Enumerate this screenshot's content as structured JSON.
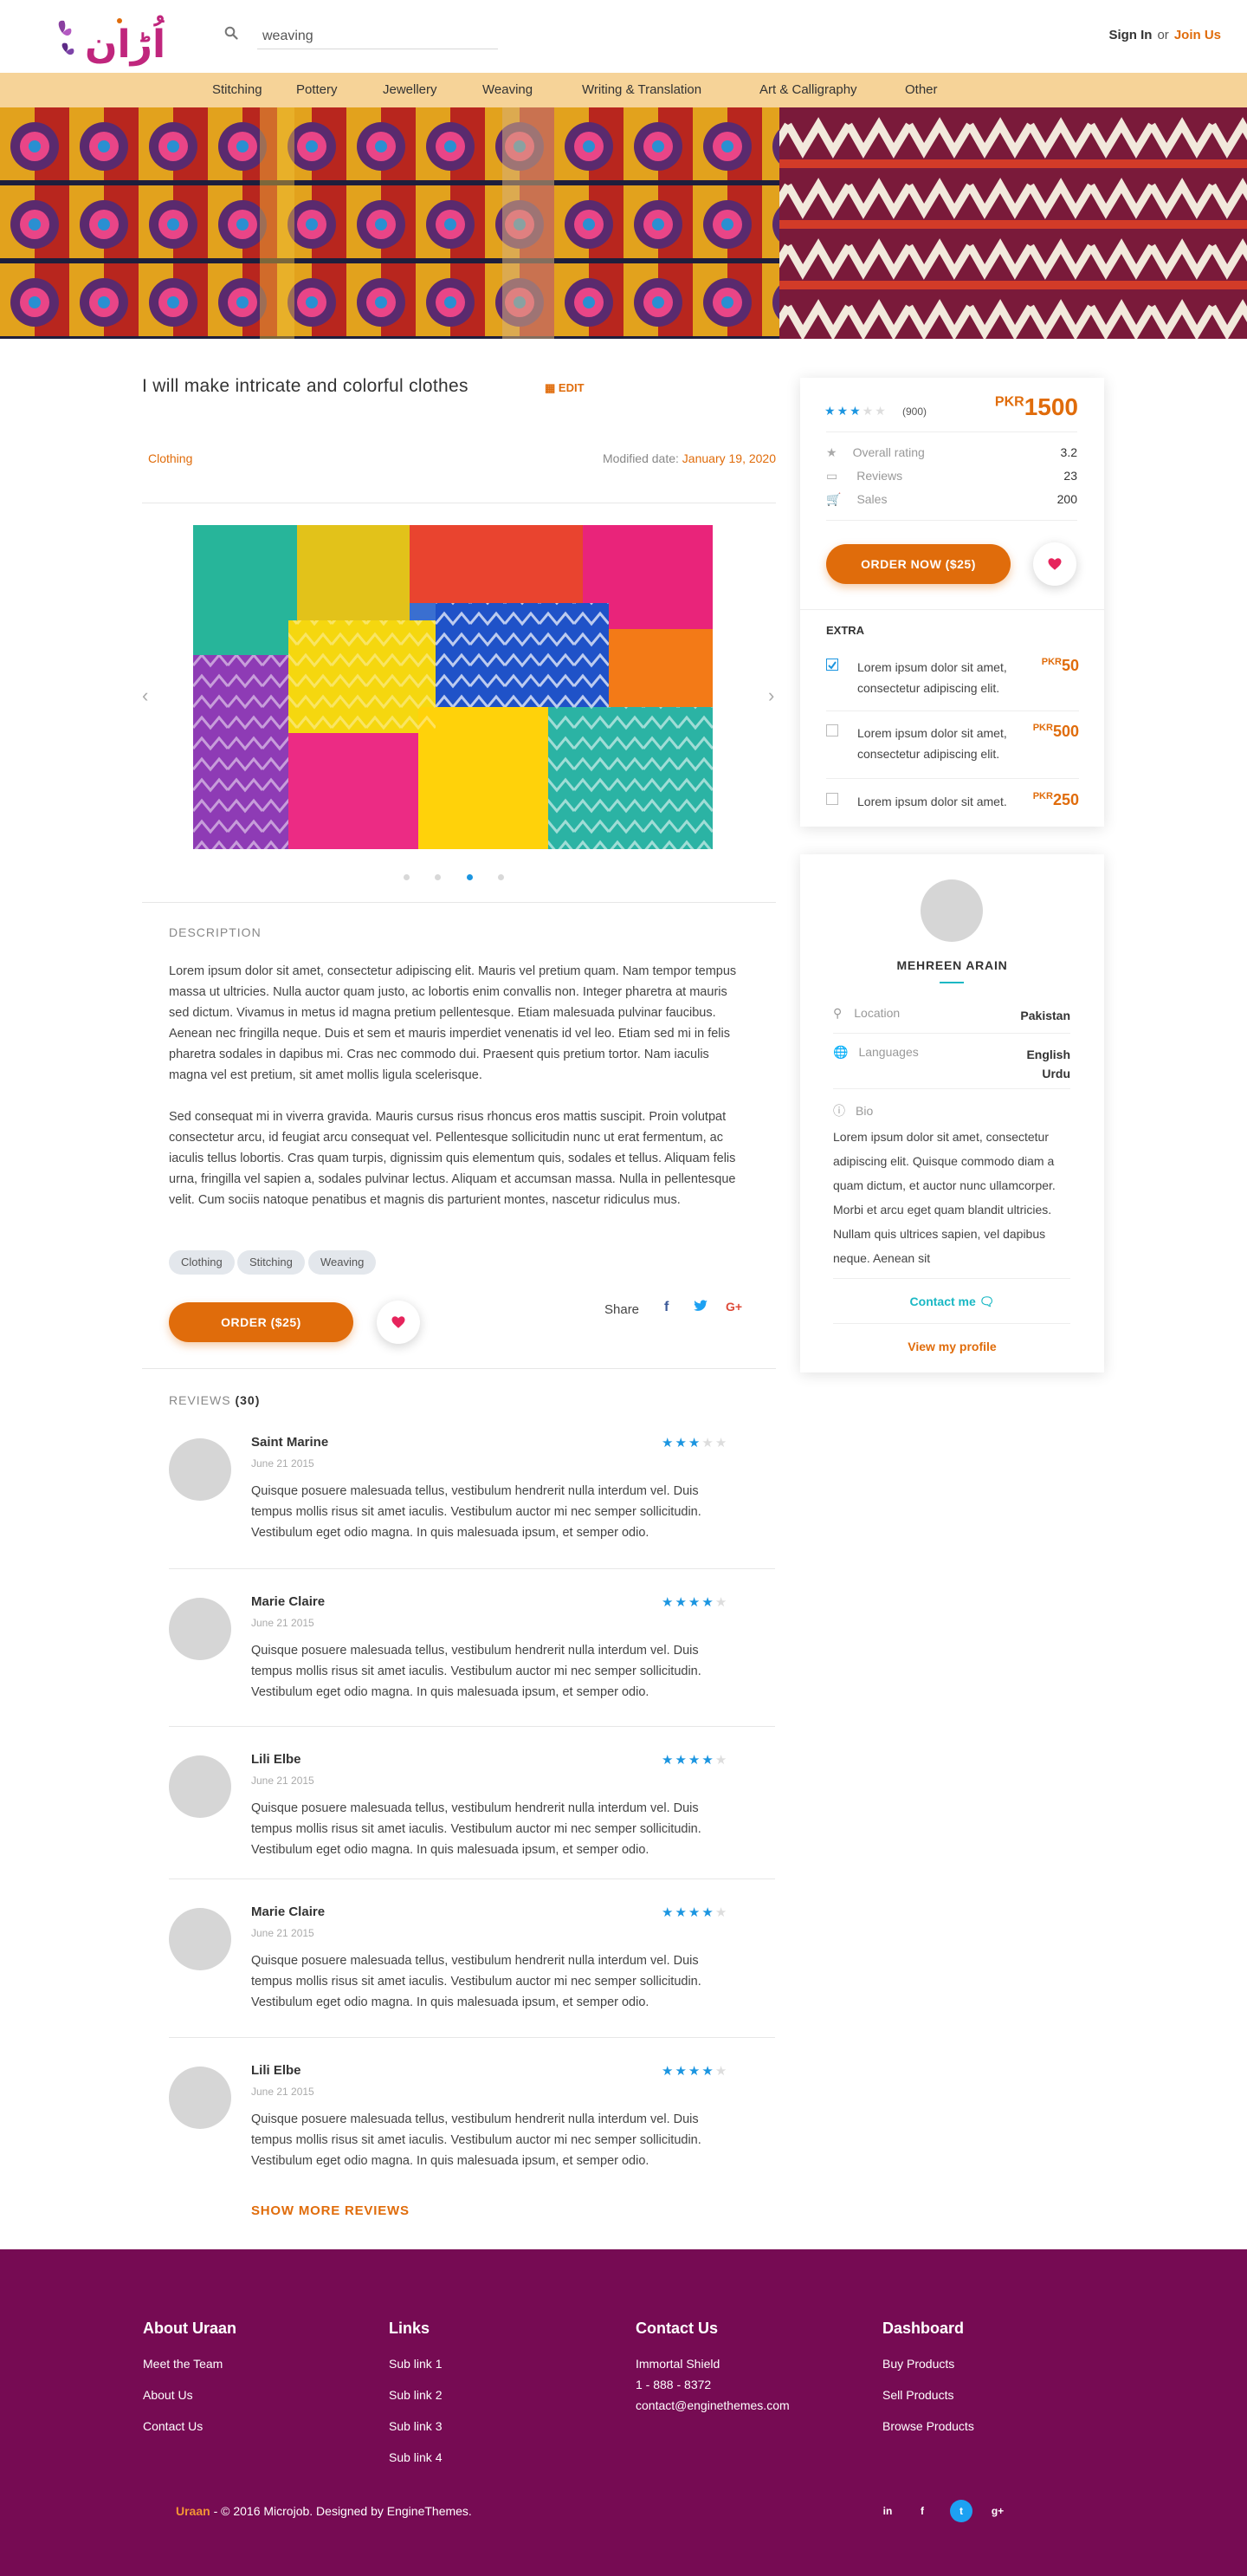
{
  "header": {
    "logo_alt": "Uraan logo",
    "search": {
      "value": "weaving",
      "placeholder": "Search"
    },
    "sign_in": "Sign In",
    "or": "or",
    "join": "Join Us"
  },
  "nav": [
    "Stitching",
    "Pottery",
    "Jewellery",
    "Weaving",
    "Writing & Translation",
    "Art & Calligraphy",
    "Other"
  ],
  "gig": {
    "title": "I will make intricate and colorful clothes",
    "edit": "EDIT",
    "category": "Clothing",
    "modified_label": "Modified date:",
    "modified_date": "January 19, 2020",
    "gallery": {
      "slide_count": 4,
      "active_slide": 3
    },
    "description_label": "DESCRIPTION",
    "description": [
      "Lorem ipsum dolor sit amet, consectetur adipiscing elit. Mauris vel pretium quam. Nam tempor tempus massa ut ultricies. Nulla auctor quam justo, ac lobortis enim convallis non. Integer pharetra at mauris sed dictum. Vivamus in metus id magna pretium pellentesque. Etiam malesuada pulvinar faucibus. Aenean nec fringilla neque. Duis et sem et mauris imperdiet venenatis id vel leo. Etiam sed mi in felis pharetra sodales in dapibus mi. Cras nec commodo dui. Praesent quis pretium tortor. Nam iaculis magna vel est pretium, sit amet mollis ligula scelerisque.",
      "Sed consequat mi in viverra gravida. Mauris cursus risus rhoncus eros mattis suscipit. Proin volutpat consectetur arcu, id feugiat arcu consequat vel. Pellentesque sollicitudin nunc ut erat fermentum, ac iaculis tellus lobortis. Cras quam turpis, dignissim quis elementum quis, sodales et tellus. Aliquam felis urna, fringilla vel sapien a, sodales pulvinar lectus. Aliquam et accumsan massa. Nulla in pellentesque velit. Cum sociis natoque penatibus et magnis dis parturient montes, nascetur ridiculus mus."
    ],
    "tags": [
      "Clothing",
      "Stitching",
      "Weaving"
    ],
    "order_label": "ORDER ($25)",
    "share_label": "Share",
    "share_icons": [
      "facebook-icon",
      "twitter-icon",
      "google-plus-icon"
    ]
  },
  "reviews": {
    "label": "REVIEWS",
    "count": "(30)",
    "items": [
      {
        "name": "Saint Marine",
        "date": "June 21 2015",
        "rating": 3,
        "text": "Quisque posuere malesuada tellus, vestibulum hendrerit nulla interdum vel. Duis tempus mollis risus sit amet iaculis. Vestibulum auctor mi nec semper sollicitudin. Vestibulum eget odio magna. In quis malesuada ipsum, et semper odio."
      },
      {
        "name": "Marie Claire",
        "date": "June 21 2015",
        "rating": 4,
        "text": "Quisque posuere malesuada tellus, vestibulum hendrerit nulla interdum vel. Duis tempus mollis risus sit amet iaculis. Vestibulum auctor mi nec semper sollicitudin. Vestibulum eget odio magna. In quis malesuada ipsum, et semper odio."
      },
      {
        "name": "Lili Elbe",
        "date": "June 21 2015",
        "rating": 4,
        "text": "Quisque posuere malesuada tellus, vestibulum hendrerit nulla interdum vel. Duis tempus mollis risus sit amet iaculis. Vestibulum auctor mi nec semper sollicitudin. Vestibulum eget odio magna. In quis malesuada ipsum, et semper odio."
      },
      {
        "name": "Marie Claire",
        "date": "June 21 2015",
        "rating": 4,
        "text": "Quisque posuere malesuada tellus, vestibulum hendrerit nulla interdum vel. Duis tempus mollis risus sit amet iaculis. Vestibulum auctor mi nec semper sollicitudin. Vestibulum eget odio magna. In quis malesuada ipsum, et semper odio."
      },
      {
        "name": "Lili Elbe",
        "date": "June 21 2015",
        "rating": 4,
        "text": "Quisque posuere malesuada tellus, vestibulum hendrerit nulla interdum vel. Duis tempus mollis risus sit amet iaculis. Vestibulum auctor mi nec semper sollicitudin. Vestibulum eget odio magna. In quis malesuada ipsum, et semper odio."
      }
    ],
    "show_more": "SHOW MORE REVIEWS"
  },
  "order_card": {
    "rating": 3,
    "rating_count": "(900)",
    "currency": "PKR",
    "price": "1500",
    "stats": [
      {
        "icon": "star-icon",
        "label": "Overall rating",
        "value": "3.2"
      },
      {
        "icon": "comment-icon",
        "label": "Reviews",
        "value": "23"
      },
      {
        "icon": "cart-icon",
        "label": "Sales",
        "value": "200"
      }
    ],
    "order_now": "ORDER NOW ($25)",
    "extra_label": "EXTRA",
    "extras": [
      {
        "checked": true,
        "text": "Lorem ipsum dolor sit amet, consectetur adipiscing elit.",
        "currency": "PKR",
        "price": "50"
      },
      {
        "checked": false,
        "text": "Lorem ipsum dolor sit amet, consectetur adipiscing elit.",
        "currency": "PKR",
        "price": "500"
      },
      {
        "checked": false,
        "text": "Lorem ipsum dolor sit amet.",
        "currency": "PKR",
        "price": "250"
      }
    ]
  },
  "profile": {
    "name": "MEHREEN ARAIN",
    "location_label": "Location",
    "location": "Pakistan",
    "languages_label": "Languages",
    "languages": [
      "English",
      "Urdu"
    ],
    "bio_label": "Bio",
    "bio": "Lorem ipsum dolor sit amet, consectetur adipiscing elit. Quisque commodo diam a quam dictum, et auctor nunc ullamcorper. Morbi et arcu eget quam blandit ultricies. Nullam quis ultrices sapien, vel dapibus neque. Aenean sit",
    "contact": "Contact me",
    "view_profile": "View my profile"
  },
  "footer": {
    "columns": [
      {
        "title": "About Uraan",
        "links": [
          "Meet the Team",
          "About Us",
          "Contact Us"
        ]
      },
      {
        "title": "Links",
        "links": [
          "Sub link 1",
          "Sub link 2",
          "Sub link 3",
          "Sub link 4"
        ]
      },
      {
        "title": "Contact Us",
        "links": [
          "Immortal Shield",
          "1 - 888 - 8372",
          "contact@enginethemes.com"
        ]
      },
      {
        "title": "Dashboard",
        "links": [
          "Buy Products",
          "Sell Products",
          "Browse Products"
        ]
      }
    ],
    "brand": "Uraan",
    "copyright": " - © 2016 Microjob. Designed by EngineThemes.",
    "social": [
      {
        "icon": "linkedin-icon",
        "glyph": "in"
      },
      {
        "icon": "facebook-icon",
        "glyph": "f"
      },
      {
        "icon": "twitter-icon",
        "glyph": "t"
      },
      {
        "icon": "google-plus-icon",
        "glyph": "g+"
      }
    ]
  },
  "colors": {
    "accent": "#e06c0b",
    "nav_bg": "#f6d398",
    "footer_bg": "#760b53",
    "star": "#1b95e0",
    "link_teal": "#1ab8c4"
  }
}
